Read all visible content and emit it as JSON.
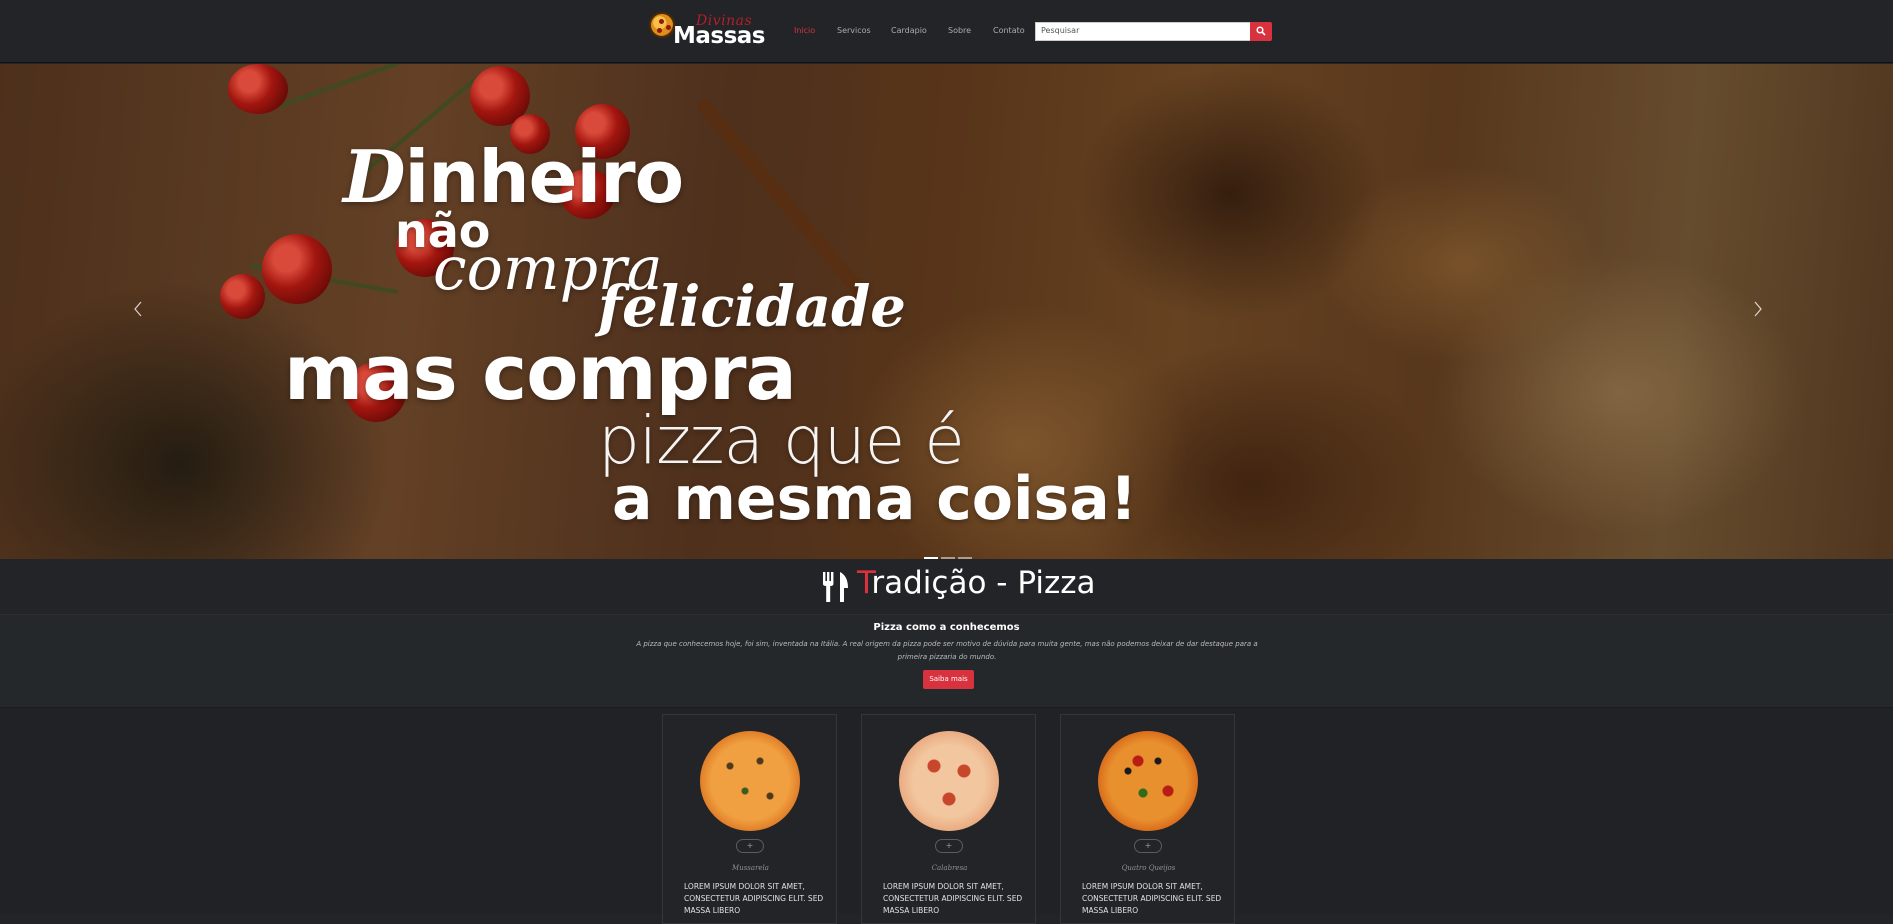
{
  "navbar": {
    "logo_script": "Divinas",
    "logo_main": "Massas",
    "items": [
      {
        "label": "Inicio",
        "active": true
      },
      {
        "label": "Servicos",
        "active": false
      },
      {
        "label": "Cardapio",
        "active": false
      },
      {
        "label": "Sobre",
        "active": false
      },
      {
        "label": "Contato",
        "active": false
      }
    ],
    "search": {
      "placeholder": "Pesquisar",
      "button_icon": "search-icon"
    }
  },
  "hero": {
    "quote": {
      "line1_cap": "D",
      "line1_rest": "inheiro",
      "line2": "não",
      "line3": "compra",
      "line4": "felicidade",
      "line5": "mas compra",
      "line6": "pizza que é",
      "line7": "a mesma coisa!"
    },
    "prev_icon": "chevron-left-icon",
    "next_icon": "chevron-right-icon",
    "slides_count": 3,
    "active_slide": 1
  },
  "section": {
    "icon": "fork-knife-icon",
    "title_first": "T",
    "title_rest": "radição - Pizza",
    "subtitle": "Pizza como a conhecemos",
    "text": "A pizza que conhecemos hoje, foi sim, inventada na Itália. A real origem da pizza pode ser motivo de dúvida para muita gente, mas não podemos deixar de dar destaque para a primeira pizzaria do mundo.",
    "button": "Saiba mais"
  },
  "cards": [
    {
      "name": "Mussarela",
      "plus": "+",
      "desc": "LOREM IPSUM DOLOR SIT AMET, CONSECTETUR ADIPISCING ELIT. SED MASSA LIBERO"
    },
    {
      "name": "Calabresa",
      "plus": "+",
      "desc": "LOREM IPSUM DOLOR SIT AMET, CONSECTETUR ADIPISCING ELIT. SED MASSA LIBERO"
    },
    {
      "name": "Quatro Queijos",
      "plus": "+",
      "desc": "LOREM IPSUM DOLOR SIT AMET, CONSECTETUR ADIPISCING ELIT. SED MASSA LIBERO"
    }
  ],
  "colors": {
    "accent": "#d9323f",
    "background": "#222427"
  }
}
